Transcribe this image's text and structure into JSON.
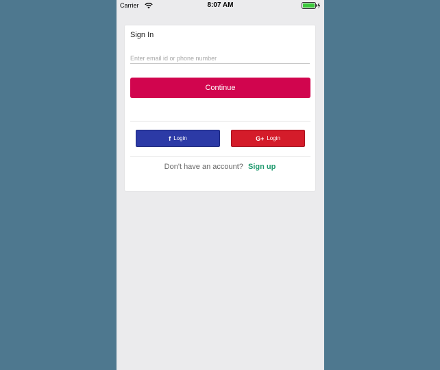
{
  "status_bar": {
    "carrier": "Carrier",
    "time": "8:07 AM",
    "wifi_icon": "wifi-icon",
    "battery_icon": "battery-charging-icon"
  },
  "card": {
    "title": "Sign In",
    "email_input": {
      "value": "",
      "placeholder": "Enter email id or phone number"
    },
    "continue_label": "Continue"
  },
  "social": {
    "facebook": {
      "icon": "facebook-icon",
      "icon_glyph": "f",
      "label": "Login",
      "color": "#2c3aa6"
    },
    "google": {
      "icon": "google-plus-icon",
      "icon_glyph": "G+",
      "label": "Login",
      "color": "#d41c2a"
    }
  },
  "signup": {
    "prompt": "Don't have an account?",
    "link_label": "Sign up",
    "link_color": "#1f9a6e"
  },
  "colors": {
    "background": "#4e788f",
    "screen": "#ebebed",
    "primary": "#d1054e"
  }
}
